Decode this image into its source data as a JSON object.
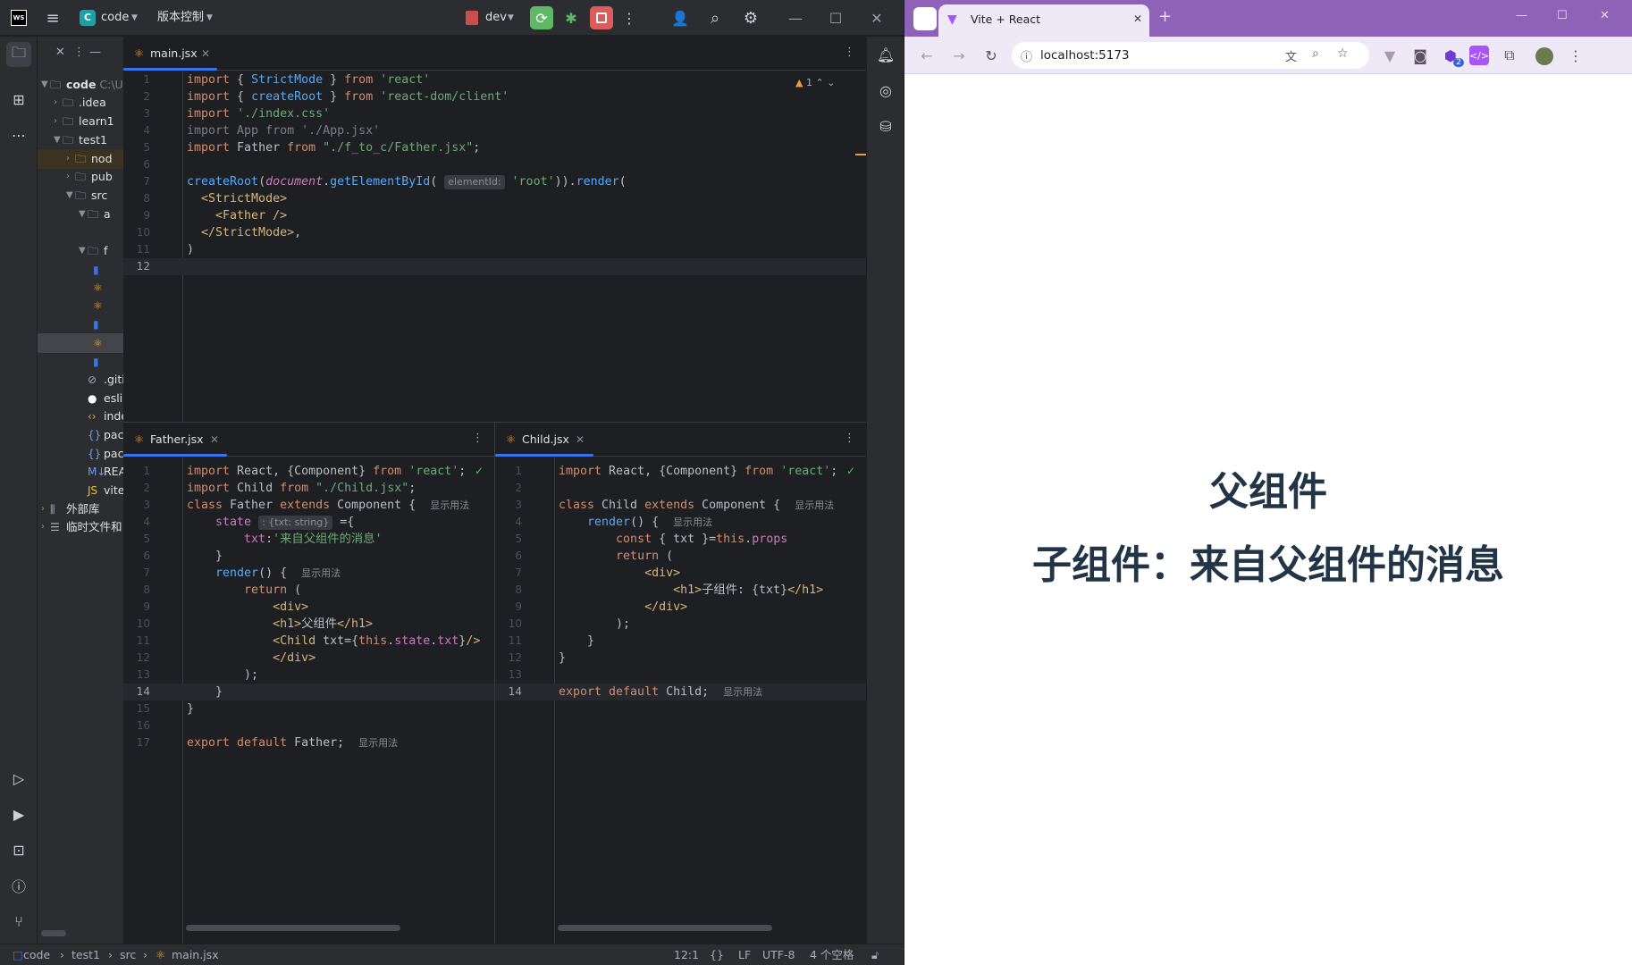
{
  "ide": {
    "app_icon": "WS",
    "project_badge": "C",
    "project_name": "code",
    "vcs_menu": "版本控制",
    "run_config": "dev",
    "project_tree": {
      "root": "code",
      "root_path": "C:\\U",
      "items": [
        ".idea",
        "learn1",
        "test1",
        "nod",
        "pub",
        "src",
        "a",
        "f",
        ".giti",
        "eslir",
        "inde",
        "pac",
        "pac",
        "REA",
        "vite.",
        "外部库",
        "临时文件和"
      ]
    },
    "main_editor": {
      "tab_name": "main.jsx",
      "warning_count": "1",
      "line_numbers": [
        "1",
        "2",
        "3",
        "4",
        "5",
        "6",
        "7",
        "8",
        "9",
        "10",
        "11",
        "12"
      ],
      "inlay_hint": "elementId:"
    },
    "father_editor": {
      "tab_name": "Father.jsx",
      "line_numbers": [
        "1",
        "2",
        "3",
        "4",
        "5",
        "6",
        "7",
        "8",
        "9",
        "10",
        "11",
        "12",
        "13",
        "14",
        "15",
        "16",
        "17"
      ],
      "state_hint": ": {txt: string}",
      "usage_hint": "显示用法"
    },
    "child_editor": {
      "tab_name": "Child.jsx",
      "line_numbers": [
        "1",
        "2",
        "3",
        "4",
        "5",
        "6",
        "7",
        "8",
        "9",
        "10",
        "11",
        "12",
        "13",
        "14"
      ],
      "usage_hint": "显示用法"
    },
    "statusbar": {
      "crumbs": [
        "code",
        "test1",
        "src",
        "main.jsx"
      ],
      "position": "12:1",
      "line_sep": "LF",
      "encoding": "UTF-8",
      "indent": "4 个空格"
    }
  },
  "browser": {
    "tab_title": "Vite + React",
    "url": "localhost:5173",
    "extension_badge": "2",
    "heading_father": "父组件",
    "heading_child": "子组件：来自父组件的消息"
  },
  "colors": {
    "ide_bg": "#1e1f22",
    "panel_bg": "#2b2d30",
    "keyword": "#cf8e6d",
    "string": "#6aab73",
    "function": "#56a8f5",
    "tag": "#d5b778",
    "browser_frame": "#8e63b7",
    "heading": "#213547"
  }
}
